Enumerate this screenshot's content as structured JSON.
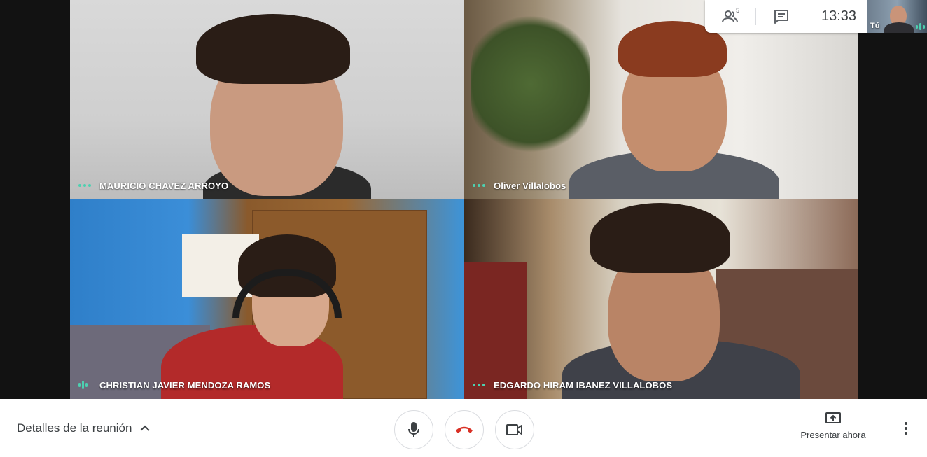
{
  "participants": [
    {
      "name": "MAURICIO CHAVEZ ARROYO",
      "audio": "dots"
    },
    {
      "name": "Oliver Villalobos",
      "audio": "dots"
    },
    {
      "name": "CHRISTIAN JAVIER MENDOZA RAMOS",
      "audio": "speaking"
    },
    {
      "name": "EDGARDO HIRAM IBANEZ VILLALOBOS",
      "audio": "dots"
    }
  ],
  "top_panel": {
    "participant_count": "5",
    "time": "13:33",
    "self_label": "Tú"
  },
  "bottom": {
    "meeting_details": "Detalles de la reunión",
    "present_label": "Presentar ahora"
  },
  "colors": {
    "audio_indicator": "#4dd0b0",
    "hangup_red": "#d93025",
    "icon_gray": "#3c4043"
  },
  "icons": {
    "people": "people-icon",
    "chat": "chat-icon",
    "mic": "microphone-icon",
    "hangup": "hang-up-icon",
    "camera": "camera-icon",
    "present": "present-screen-icon",
    "more": "more-vert-icon",
    "chevron": "chevron-up-icon"
  }
}
